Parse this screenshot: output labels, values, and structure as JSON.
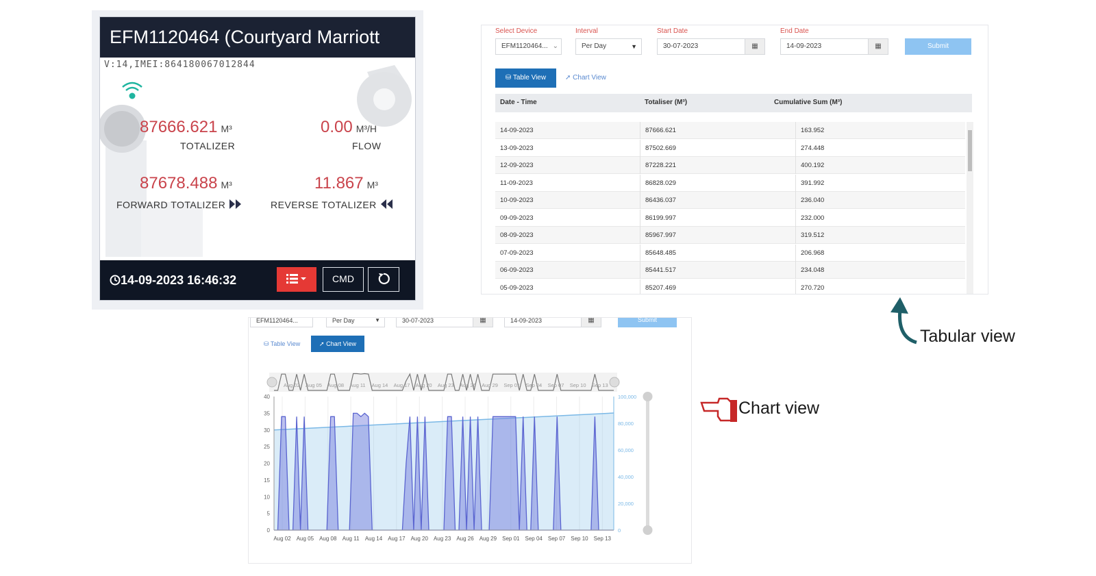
{
  "device_card": {
    "title": "EFM1120464 (Courtyard Marriott",
    "subtitle": "V:14,IMEI:864180067012844",
    "totalizer": {
      "value": "87666.621",
      "unit": "M³",
      "label": "TOTALIZER"
    },
    "flow": {
      "value": "0.00",
      "unit": "M³/H",
      "label": "FLOW"
    },
    "forward_totalizer": {
      "value": "87678.488",
      "unit": "M³",
      "label": "FORWARD TOTALIZER"
    },
    "reverse_totalizer": {
      "value": "11.867",
      "unit": "M³",
      "label": "REVERSE TOTALIZER"
    },
    "timestamp": "14-09-2023 16:46:32",
    "cmd_label": "CMD"
  },
  "table_panel": {
    "filters": {
      "device_label": "Select Device",
      "device_value": "EFM1120464...",
      "interval_label": "Interval",
      "interval_value": "Per Day",
      "start_label": "Start Date",
      "start_value": "30-07-2023",
      "end_label": "End Date",
      "end_value": "14-09-2023",
      "submit": "Submit"
    },
    "tabs": {
      "table": "Table View",
      "chart": "Chart View"
    },
    "columns": [
      "Date - Time",
      "Totaliser (M³)",
      "Cumulative Sum (M³)"
    ],
    "rows": [
      [
        "14-09-2023",
        "87666.621",
        "163.952"
      ],
      [
        "13-09-2023",
        "87502.669",
        "274.448"
      ],
      [
        "12-09-2023",
        "87228.221",
        "400.192"
      ],
      [
        "11-09-2023",
        "86828.029",
        "391.992"
      ],
      [
        "10-09-2023",
        "86436.037",
        "236.040"
      ],
      [
        "09-09-2023",
        "86199.997",
        "232.000"
      ],
      [
        "08-09-2023",
        "85967.997",
        "319.512"
      ],
      [
        "07-09-2023",
        "85648.485",
        "206.968"
      ],
      [
        "06-09-2023",
        "85441.517",
        "234.048"
      ],
      [
        "05-09-2023",
        "85207.469",
        "270.720"
      ]
    ]
  },
  "chart_panel": {
    "filters": {
      "device_value": "EFM1120464...",
      "interval_value": "Per Day",
      "start_value": "30-07-2023",
      "end_value": "14-09-2023",
      "submit": "Submit"
    },
    "tabs": {
      "table": "Table View",
      "chart": "Chart View"
    }
  },
  "chart_data": {
    "type": "area",
    "x_ticks": [
      "Aug 02",
      "Aug 05",
      "Aug 08",
      "Aug 11",
      "Aug 14",
      "Aug 17",
      "Aug 20",
      "Aug 23",
      "Aug 26",
      "Aug 29",
      "Sep 01",
      "Sep 04",
      "Sep 07",
      "Sep 10",
      "Sep 13"
    ],
    "navigator_ticks": [
      "Aug 02",
      "Aug 05",
      "Aug 08",
      "Aug 11",
      "Aug 14",
      "Aug 17",
      "Aug 20",
      "Aug 23",
      "Aug 26",
      "Aug 29",
      "Sep 01",
      "Sep 04",
      "Sep 07",
      "Sep 10",
      "Sep 13"
    ],
    "y_left_ticks": [
      "0",
      "5",
      "10",
      "15",
      "20",
      "25",
      "30",
      "35",
      "40"
    ],
    "y_left_range": [
      0,
      40
    ],
    "y_right_ticks": [
      "0",
      "20,000",
      "40,000",
      "60,000",
      "80,000",
      "100,000"
    ],
    "y_right_range": [
      0,
      100000
    ],
    "series": [
      {
        "color": "#5a64d0",
        "x": [
          0,
          0.5,
          1,
          1.5,
          2,
          2.5,
          3,
          3.5,
          4,
          4.5,
          5,
          5.5,
          6,
          6.5,
          7,
          7.5,
          8,
          8.5,
          9,
          9.5,
          10,
          10.5,
          11,
          11.5,
          12,
          12.5,
          13,
          13.5,
          14,
          14.5,
          15,
          15.5,
          16,
          16.5,
          17,
          17.5,
          18,
          18.5,
          19,
          19.5,
          20,
          20.5,
          21,
          21.5,
          22,
          22.5,
          23,
          23.5,
          24,
          24.5,
          25,
          25.5,
          26,
          26.5,
          27,
          27.5,
          28,
          28.5,
          29,
          29.5,
          30,
          30.5,
          31,
          31.5,
          32,
          32.5,
          33,
          33.5,
          34,
          34.5,
          35,
          35.5,
          36,
          36.5,
          37,
          37.5,
          38,
          38.5,
          39,
          39.5,
          40,
          40.5,
          41,
          41.5,
          42,
          42.5,
          43,
          43.5,
          44,
          44.5,
          45
        ],
        "values": [
          0,
          0,
          34,
          34,
          0,
          0,
          34,
          0,
          34,
          0,
          0,
          0,
          0,
          0,
          0,
          34,
          34,
          0,
          0,
          0,
          0,
          35,
          35,
          34,
          35,
          34,
          0,
          0,
          0,
          0,
          0,
          0,
          0,
          0,
          0,
          20,
          34,
          0,
          34,
          0,
          34,
          0,
          0,
          0,
          0,
          0,
          34,
          34,
          0,
          0,
          34,
          0,
          34,
          0,
          34,
          0,
          0,
          0,
          34,
          34,
          34,
          34,
          34,
          34,
          34,
          0,
          34,
          0,
          0,
          34,
          0,
          0,
          0,
          0,
          0,
          34,
          0,
          0,
          0,
          0,
          0,
          0,
          0,
          0,
          0,
          34,
          0,
          0,
          0,
          0,
          0
        ]
      },
      {
        "color": "#7ab8e6",
        "x": [
          0,
          45
        ],
        "values": [
          75000,
          87666.621
        ]
      }
    ]
  },
  "annotations": {
    "tabular": "Tabular view",
    "chart": "Chart view"
  }
}
